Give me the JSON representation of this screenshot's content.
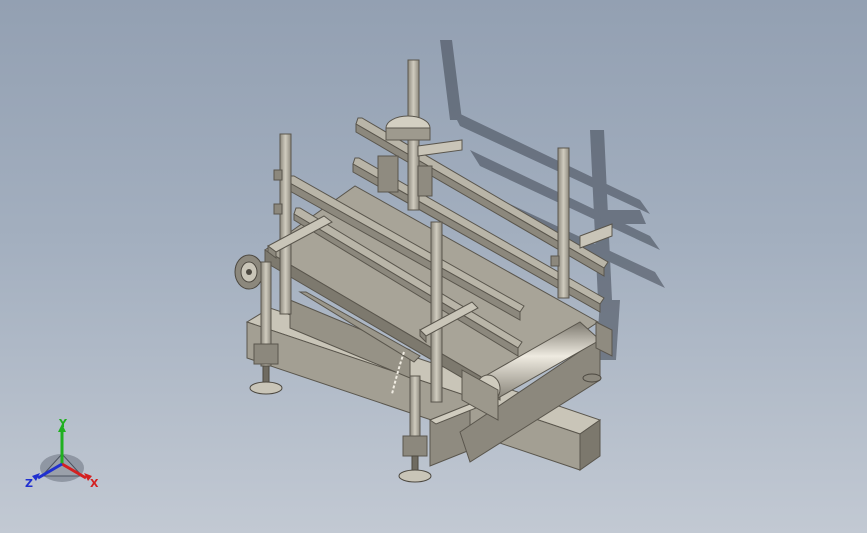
{
  "viewport": {
    "background_top": "#93a0b2",
    "background_bottom": "#c2c9d3"
  },
  "model": {
    "subject": "belt-conveyor-assembly",
    "color_metal": "#a39f93",
    "color_metal_light": "#c9c5b8",
    "color_metal_dark": "#6f6b61",
    "color_shadow": "#3f4652"
  },
  "triad": {
    "x_label": "X",
    "y_label": "Y",
    "z_label": "Z",
    "x_color": "#d42020",
    "y_color": "#20b020",
    "z_color": "#2030d0"
  }
}
